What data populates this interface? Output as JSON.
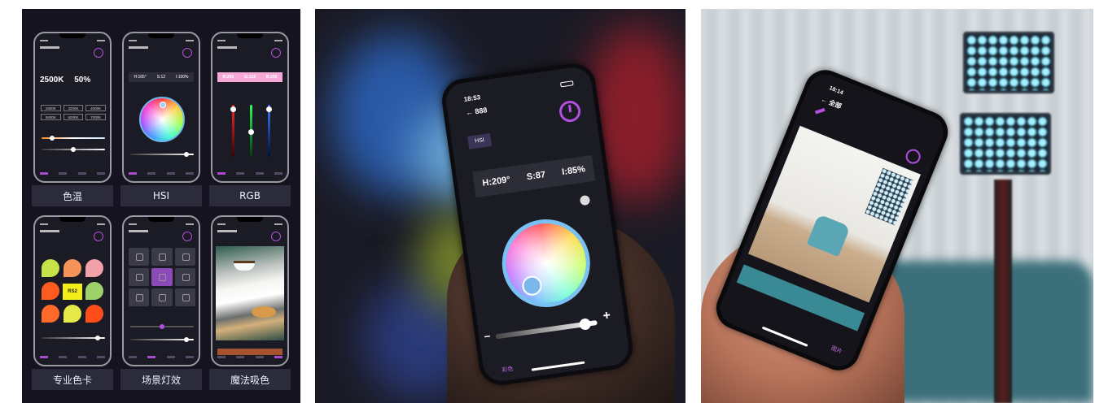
{
  "panel1": {
    "cells": [
      {
        "label": "色温",
        "cct_value": "2500K",
        "brightness": "50%",
        "presets": [
          "2800K",
          "3200K",
          "4000K",
          "5500K",
          "6000K",
          "7000K"
        ]
      },
      {
        "label": "HSI",
        "h": "H:165°",
        "s": "S:12",
        "i": "I:100%"
      },
      {
        "label": "RGB",
        "r": "R:255",
        "g": "G:123",
        "b": "B:255"
      },
      {
        "label": "专业色卡",
        "selected_card": "RS2"
      },
      {
        "label": "场景灯效"
      },
      {
        "label": "魔法吸色"
      }
    ]
  },
  "panel2": {
    "time": "18:53",
    "back_title": "← 888",
    "mode_tab": "HSI",
    "h": "H:209°",
    "s": "S:87",
    "i": "I:85%",
    "plus": "+",
    "minus": "–",
    "nav_label": "彩色"
  },
  "panel3": {
    "time": "18:14",
    "back_title": "← 全部",
    "nav_label": "图片"
  },
  "colors": {
    "accent_purple": "#b14fe0",
    "wheel_ring_blue": "#79c1f2",
    "rgb_pink": "#f7a8d8",
    "card_yellow": "#f2ee1a"
  }
}
